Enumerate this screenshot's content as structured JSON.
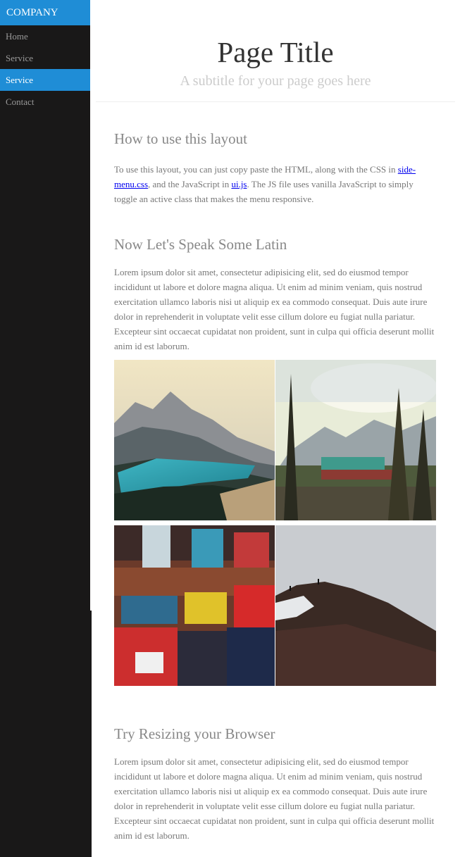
{
  "sidebar": {
    "brand": "COMPANY",
    "items": [
      {
        "label": "Home"
      },
      {
        "label": "Service"
      },
      {
        "label": "Service"
      },
      {
        "label": "Contact"
      }
    ],
    "active_index": 2
  },
  "header": {
    "title": "Page Title",
    "subtitle": "A subtitle for your page goes here"
  },
  "sections": {
    "usage": {
      "title": "How to use this layout",
      "text_1": "To use this layout, you can just copy paste the HTML, along with the CSS in ",
      "link_css": "side-menu.css",
      "text_2": ", and the JavaScript in ",
      "link_js": "ui.js",
      "text_3": ". The JS file uses vanilla JavaScript to simply toggle an active class that makes the menu responsive."
    },
    "latin": {
      "title": "Now Let's Speak Some Latin",
      "text": "Lorem ipsum dolor sit amet, consectetur adipisicing elit, sed do eiusmod tempor incididunt ut labore et dolore magna aliqua. Ut enim ad minim veniam, quis nostrud exercitation ullamco laboris nisi ut aliquip ex ea commodo consequat. Duis aute irure dolor in reprehenderit in voluptate velit esse cillum dolore eu fugiat nulla pariatur. Excepteur sint occaecat cupidatat non proident, sunt in culpa qui officia deserunt mollit anim id est laborum."
    },
    "resize": {
      "title": "Try Resizing your Browser",
      "text": "Lorem ipsum dolor sit amet, consectetur adipisicing elit, sed do eiusmod tempor incididunt ut labore et dolore magna aliqua. Ut enim ad minim veniam, quis nostrud exercitation ullamco laboris nisi ut aliquip ex ea commodo consequat. Duis aute irure dolor in reprehenderit in voluptate velit esse cillum dolore eu fugiat nulla pariatur. Excepteur sint occaecat cupidatat non proident, sunt in culpa qui officia deserunt mollit anim id est laborum."
    }
  },
  "colors": {
    "accent": "#1f8dd6",
    "sidebar_bg": "#191818",
    "nav_text": "#999999"
  }
}
